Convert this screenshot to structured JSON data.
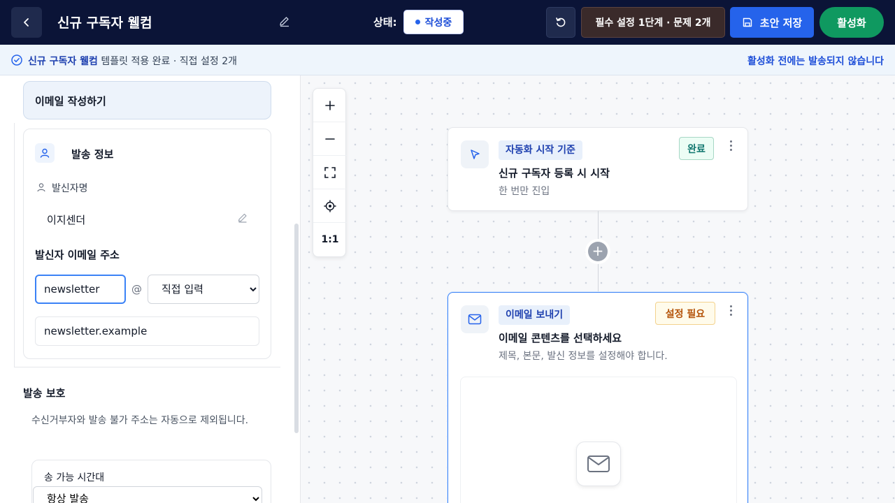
{
  "header": {
    "title": "신규 구독자 웰컴",
    "status_label": "상태:",
    "status_value": "작성중",
    "issues_label": "필수 설정 1단계 · 문제 2개",
    "save_label": "초안 저장",
    "activate_label": "활성화"
  },
  "notice": {
    "template_name": "신규 구독자 웰컴",
    "message": " 템플릿 적용 완료 · 직접 설정 2개",
    "right_text": "활성화 전에는 발송되지 않습니다"
  },
  "left_panel": {
    "compose_title": "이메일 작성하기",
    "info_title": "발송 정보",
    "sender_name_label": "발신자명",
    "sender_name_value": "이지센더",
    "email_label": "발신자 이메일 주소",
    "email_local_value": "newsletter",
    "at_sign": "@",
    "domain_select_value": "직접 입력",
    "domain_value": "newsletter.example",
    "protect_title": "발송 보호",
    "protect_desc": "수신거부자와 발송 불가 주소는 자동으로 제외됩니다.",
    "window_label": "송 가능 시간대",
    "window_value": "항상 발송"
  },
  "zoom_tools": {
    "fit_label": "1:1"
  },
  "nodes": {
    "trigger": {
      "tag": "자동화 시작 기준",
      "title": "신규 구독자 등록 시 시작",
      "sub": "한 번만 진입",
      "badge": "완료"
    },
    "email": {
      "tag": "이메일 보내기",
      "title": "이메일 콘텐츠를 선택하세요",
      "sub": "제목, 본문, 발신 정보를 설정해야 합니다.",
      "badge": "설정 필요"
    }
  },
  "colors": {
    "topbar": "#0b1437",
    "primary": "#2563eb",
    "success": "#0f9960",
    "warning": "#b45309"
  }
}
